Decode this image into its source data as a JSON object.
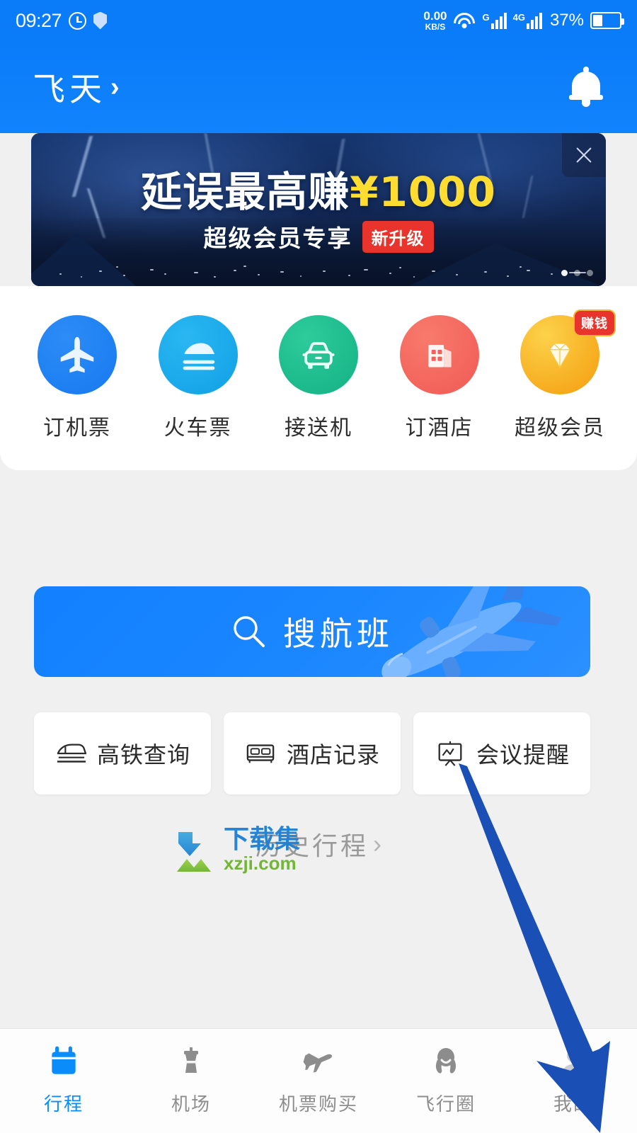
{
  "statusbar": {
    "time": "09:27",
    "alarm_icon": "alarm-clock-icon",
    "shield_icon": "shield-icon",
    "netspeed_value": "0.00",
    "netspeed_unit": "KB/S",
    "wifi_icon": "wifi-icon",
    "signal1_label": "G",
    "signal2_label": "4G",
    "battery_percent": "37%"
  },
  "header": {
    "brand": "飞天",
    "chevron": "›",
    "bell_icon": "bell-icon",
    "bg_color": "#0a7cfa"
  },
  "banner": {
    "title_white": "延误最高赚",
    "title_yellow": "¥1000",
    "subtitle": "超级会员专享",
    "badge": "新升级",
    "close_icon": "close-icon",
    "accent_yellow": "#ffdc32",
    "badge_color": "#e8342c",
    "dots_total": 3,
    "dots_active": 0
  },
  "quick_actions": [
    {
      "label": "订机票",
      "icon": "airplane-icon",
      "color": "#1679f0",
      "color2": "#2d8cf6",
      "badge": null
    },
    {
      "label": "火车票",
      "icon": "train-icon",
      "color": "#16a6e8",
      "color2": "#2ab7f2",
      "badge": null
    },
    {
      "label": "接送机",
      "icon": "car-icon",
      "color": "#16b98a",
      "color2": "#2ecb9b",
      "badge": null
    },
    {
      "label": "订酒店",
      "icon": "hotel-icon",
      "color": "#f4615d",
      "color2": "#f87a6c",
      "badge": null
    },
    {
      "label": "超级会员",
      "icon": "diamond-icon",
      "color": "#f9b718",
      "color2": "#fcd24a",
      "badge": "赚钱"
    }
  ],
  "search": {
    "label": "搜航班",
    "icon": "search-icon",
    "plane_icon": "airplane-illustration",
    "color": "#1a86ff"
  },
  "shortcuts": [
    {
      "label": "高铁查询",
      "icon": "high-speed-train-icon"
    },
    {
      "label": "酒店记录",
      "icon": "bed-icon"
    },
    {
      "label": "会议提醒",
      "icon": "presentation-board-icon"
    }
  ],
  "history": {
    "label": "历史行程",
    "chevron": "›"
  },
  "watermark": {
    "title": "下载集",
    "domain": "xzji.com",
    "logo_icon": "download-arrow-logo"
  },
  "annotation": {
    "arrow_icon": "pointer-arrow",
    "color": "#1a4fb5",
    "from": "会议提醒",
    "to": "我的"
  },
  "bottom_nav": {
    "active_color": "#0a8cfa",
    "inactive_color": "#8d8d8d",
    "items": [
      {
        "label": "行程",
        "icon": "calendar-icon",
        "active": true
      },
      {
        "label": "机场",
        "icon": "control-tower-icon",
        "active": false
      },
      {
        "label": "机票购买",
        "icon": "airplane-icon",
        "active": false
      },
      {
        "label": "飞行圈",
        "icon": "community-icon",
        "active": false
      },
      {
        "label": "我的",
        "icon": "profile-icon",
        "active": false
      }
    ]
  }
}
